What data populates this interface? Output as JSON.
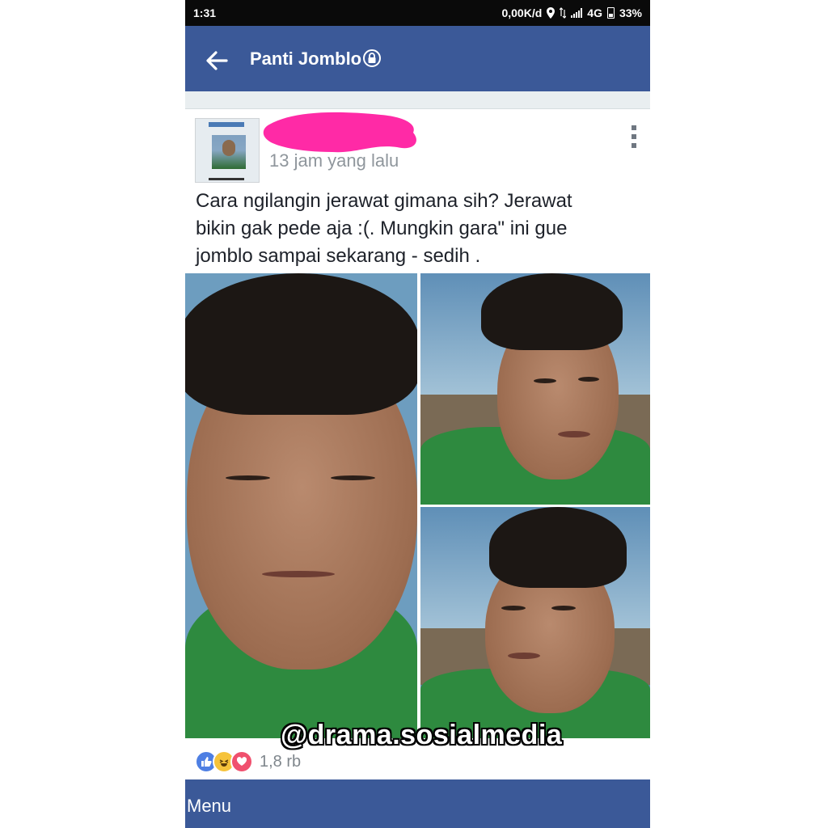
{
  "status_bar": {
    "time": "1:31",
    "network_speed": "0,00K/d",
    "network_type": "4G",
    "battery": "33%",
    "icons": [
      "location-icon",
      "data-arrows-icon",
      "signal-icon",
      "battery-icon"
    ]
  },
  "header": {
    "title": "Panti Jomblo",
    "back_icon": "back-arrow-icon",
    "lock_icon": "lock-icon",
    "background_color": "#3b5998"
  },
  "post": {
    "time_label": "13 jam yang lalu",
    "author_redacted": true,
    "text": "Cara ngilangin jerawat gimana sih? Jerawat\nbikin gak pede aja :(. Mungkin gara\" ini gue\njomblo sampai sekarang - sedih .",
    "photos": [
      "selfie-front",
      "selfie-right-side",
      "selfie-left-side"
    ],
    "reaction_icons": [
      "like-icon",
      "haha-icon",
      "love-icon"
    ],
    "reaction_count": "1,8 rb"
  },
  "watermark": "@drama.sosialmedia",
  "bottom_bar": {
    "menu_label": "Menu"
  }
}
